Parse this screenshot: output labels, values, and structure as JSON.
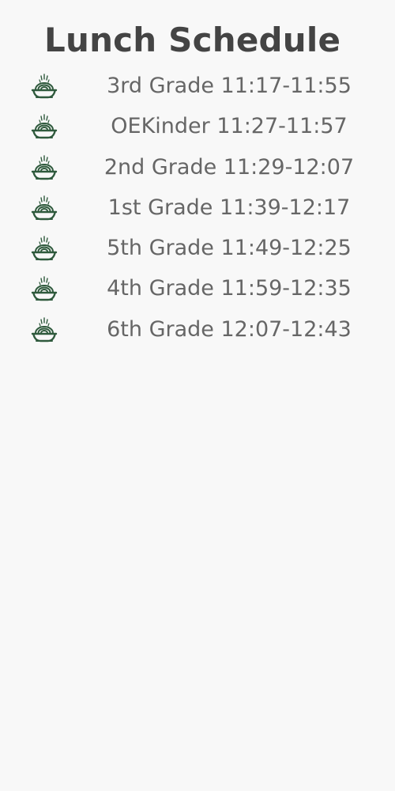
{
  "header": {
    "title": "Lunch Schedule"
  },
  "colors": {
    "icon": "#2f5a3d",
    "title": "#444444",
    "text": "#666666",
    "background": "#f8f8f8"
  },
  "schedule": {
    "icon_name": "food-bowl-icon",
    "items": [
      {
        "label": "3rd Grade 11:17-11:55"
      },
      {
        "label": "OEKinder 11:27-11:57"
      },
      {
        "label": "2nd Grade 11:29-12:07"
      },
      {
        "label": "1st Grade 11:39-12:17"
      },
      {
        "label": "5th Grade 11:49-12:25"
      },
      {
        "label": "4th Grade 11:59-12:35"
      },
      {
        "label": "6th Grade 12:07-12:43"
      }
    ]
  }
}
